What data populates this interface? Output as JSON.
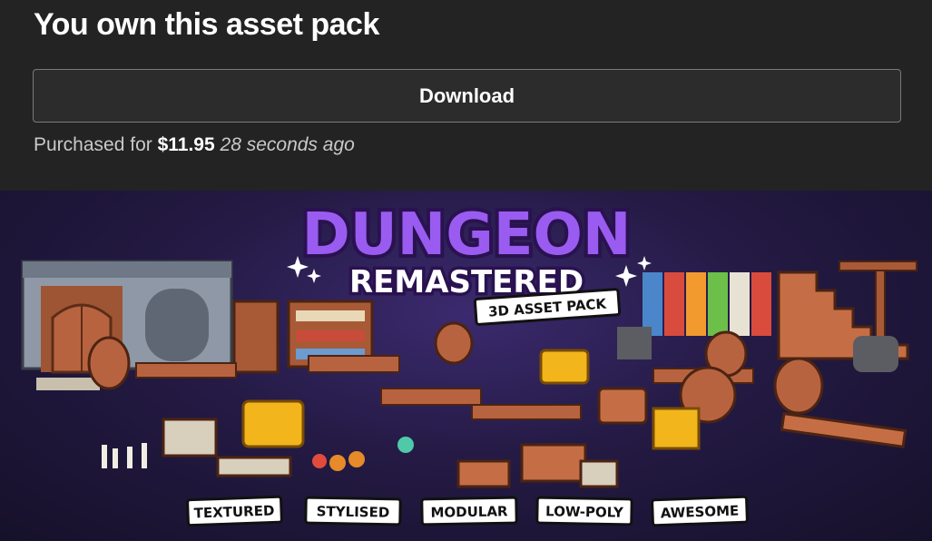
{
  "purchase": {
    "title": "You own this asset pack",
    "download_label": "Download",
    "purchased_prefix": "Purchased for",
    "price": "$11.95",
    "time_ago": "28 seconds ago"
  },
  "banner": {
    "logo_line1": "DUNGEON",
    "logo_line2": "REMASTERED",
    "subtitle": "3D ASSET PACK",
    "tags": [
      "TEXTURED",
      "STYLISED",
      "MODULAR",
      "LOW-POLY",
      "AWESOME"
    ],
    "colors": {
      "logo_purple": "#9a5cf0",
      "logo_outline": "#2a1250",
      "wood": "#b8633f",
      "stone": "#8b96a3",
      "gold": "#f2b51c"
    }
  }
}
